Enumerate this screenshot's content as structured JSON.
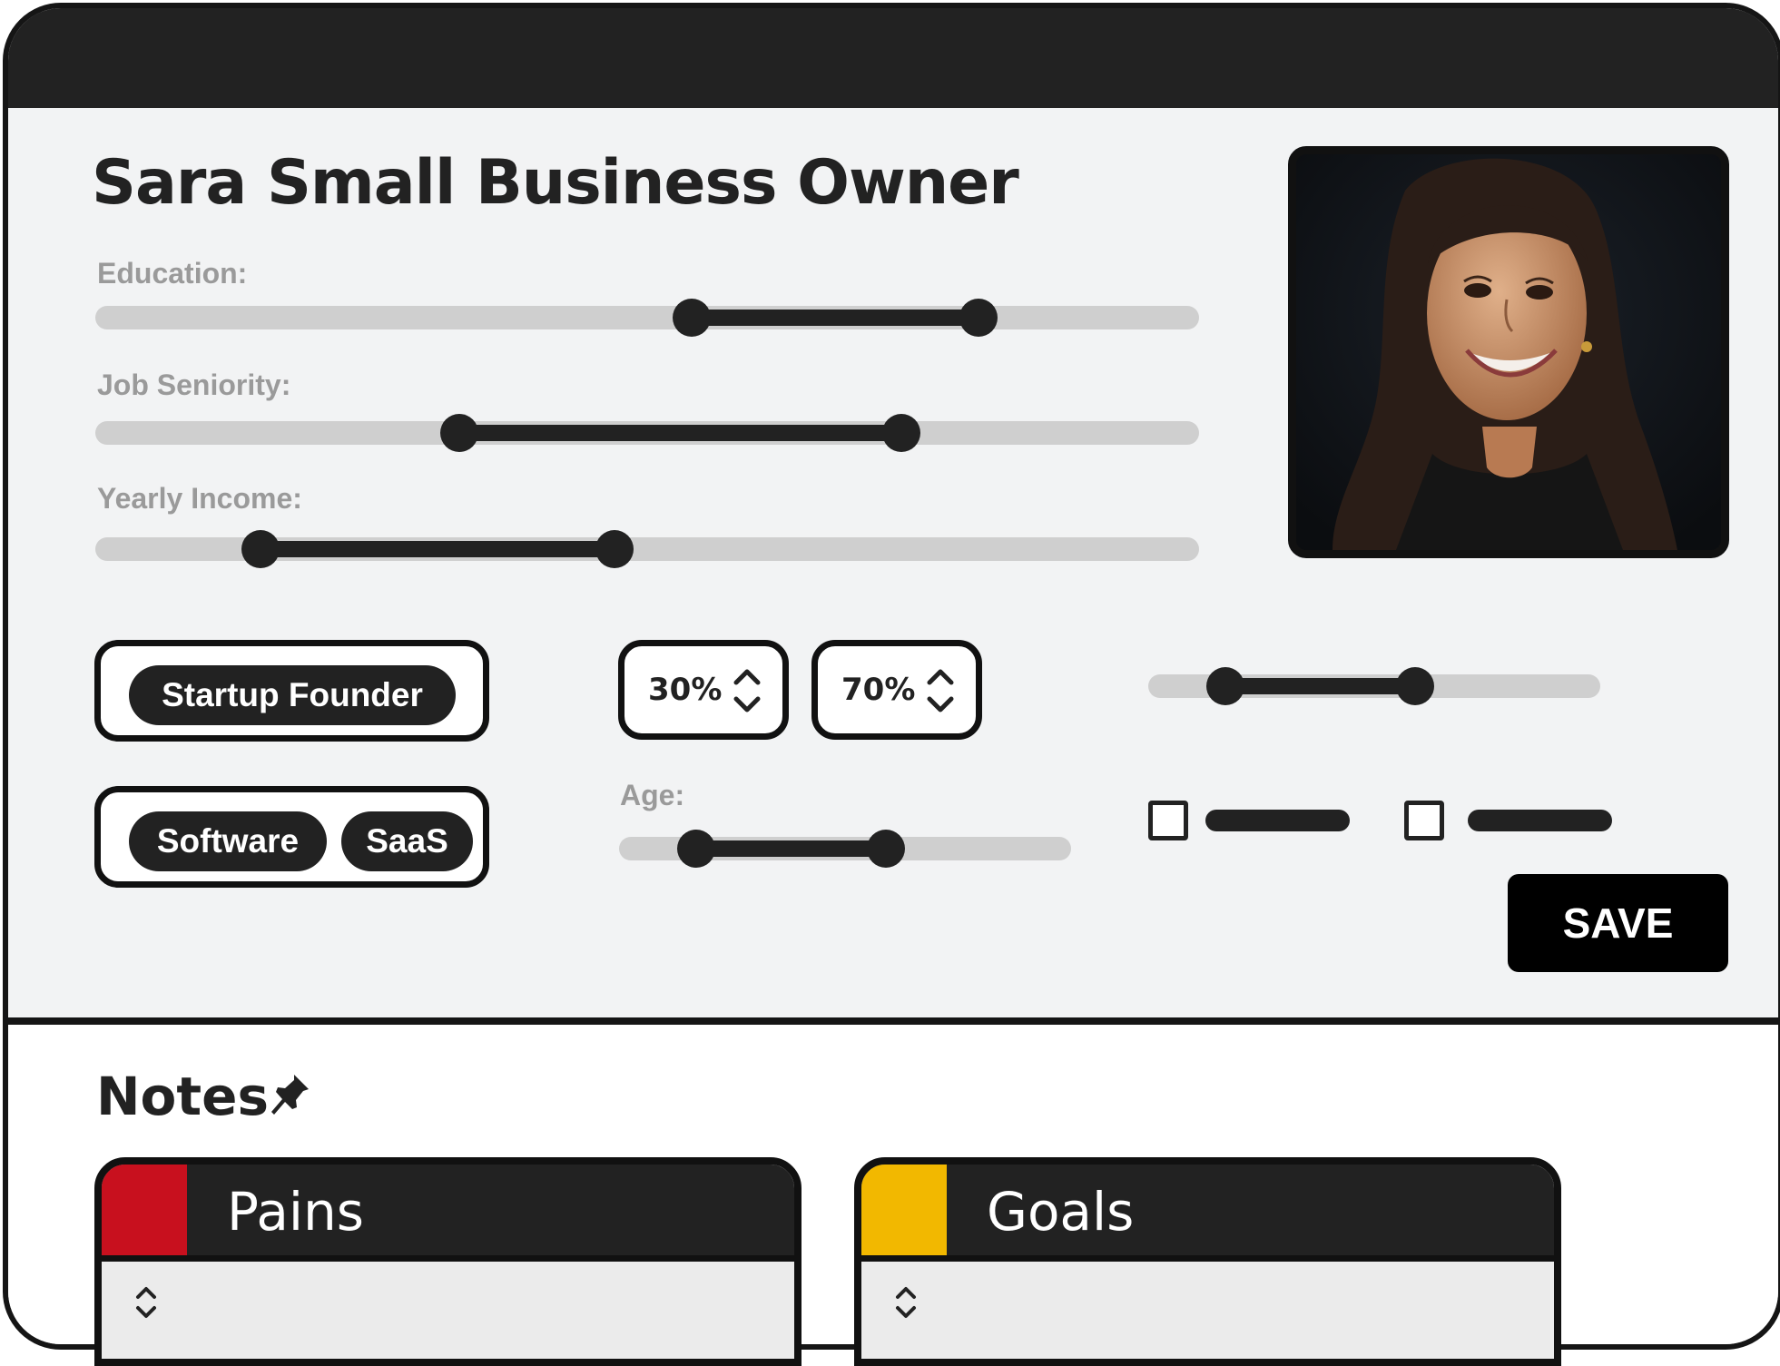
{
  "persona": {
    "name": "Sara Small Business Owner"
  },
  "sliders": [
    {
      "label": "Education:",
      "range": [
        0.54,
        0.8
      ]
    },
    {
      "label": "Job Seniority:",
      "range": [
        0.33,
        0.73
      ]
    },
    {
      "label": "Yearly Income:",
      "range": [
        0.15,
        0.47
      ]
    },
    {
      "label": "",
      "range": [
        0.17,
        0.59
      ]
    },
    {
      "label": "Age:",
      "range": [
        0.17,
        0.59
      ]
    }
  ],
  "tags": {
    "role": [
      "Startup Founder"
    ],
    "industry": [
      "Software",
      "SaaS"
    ]
  },
  "steppers": [
    {
      "value": "30%"
    },
    {
      "value": "70%"
    }
  ],
  "checkboxes": [
    {
      "checked": false
    },
    {
      "checked": false
    }
  ],
  "actions": {
    "save_label": "SAVE"
  },
  "notes": {
    "title": "Notes",
    "icon": "pin-icon",
    "cards": [
      {
        "title": "Pains",
        "color": "#c8101e"
      },
      {
        "title": "Goals",
        "color": "#f2b800"
      }
    ]
  },
  "colors": {
    "frame": "#151515",
    "panel": "#f2f3f4",
    "track": "#cfcfcf",
    "fill": "#222222"
  }
}
